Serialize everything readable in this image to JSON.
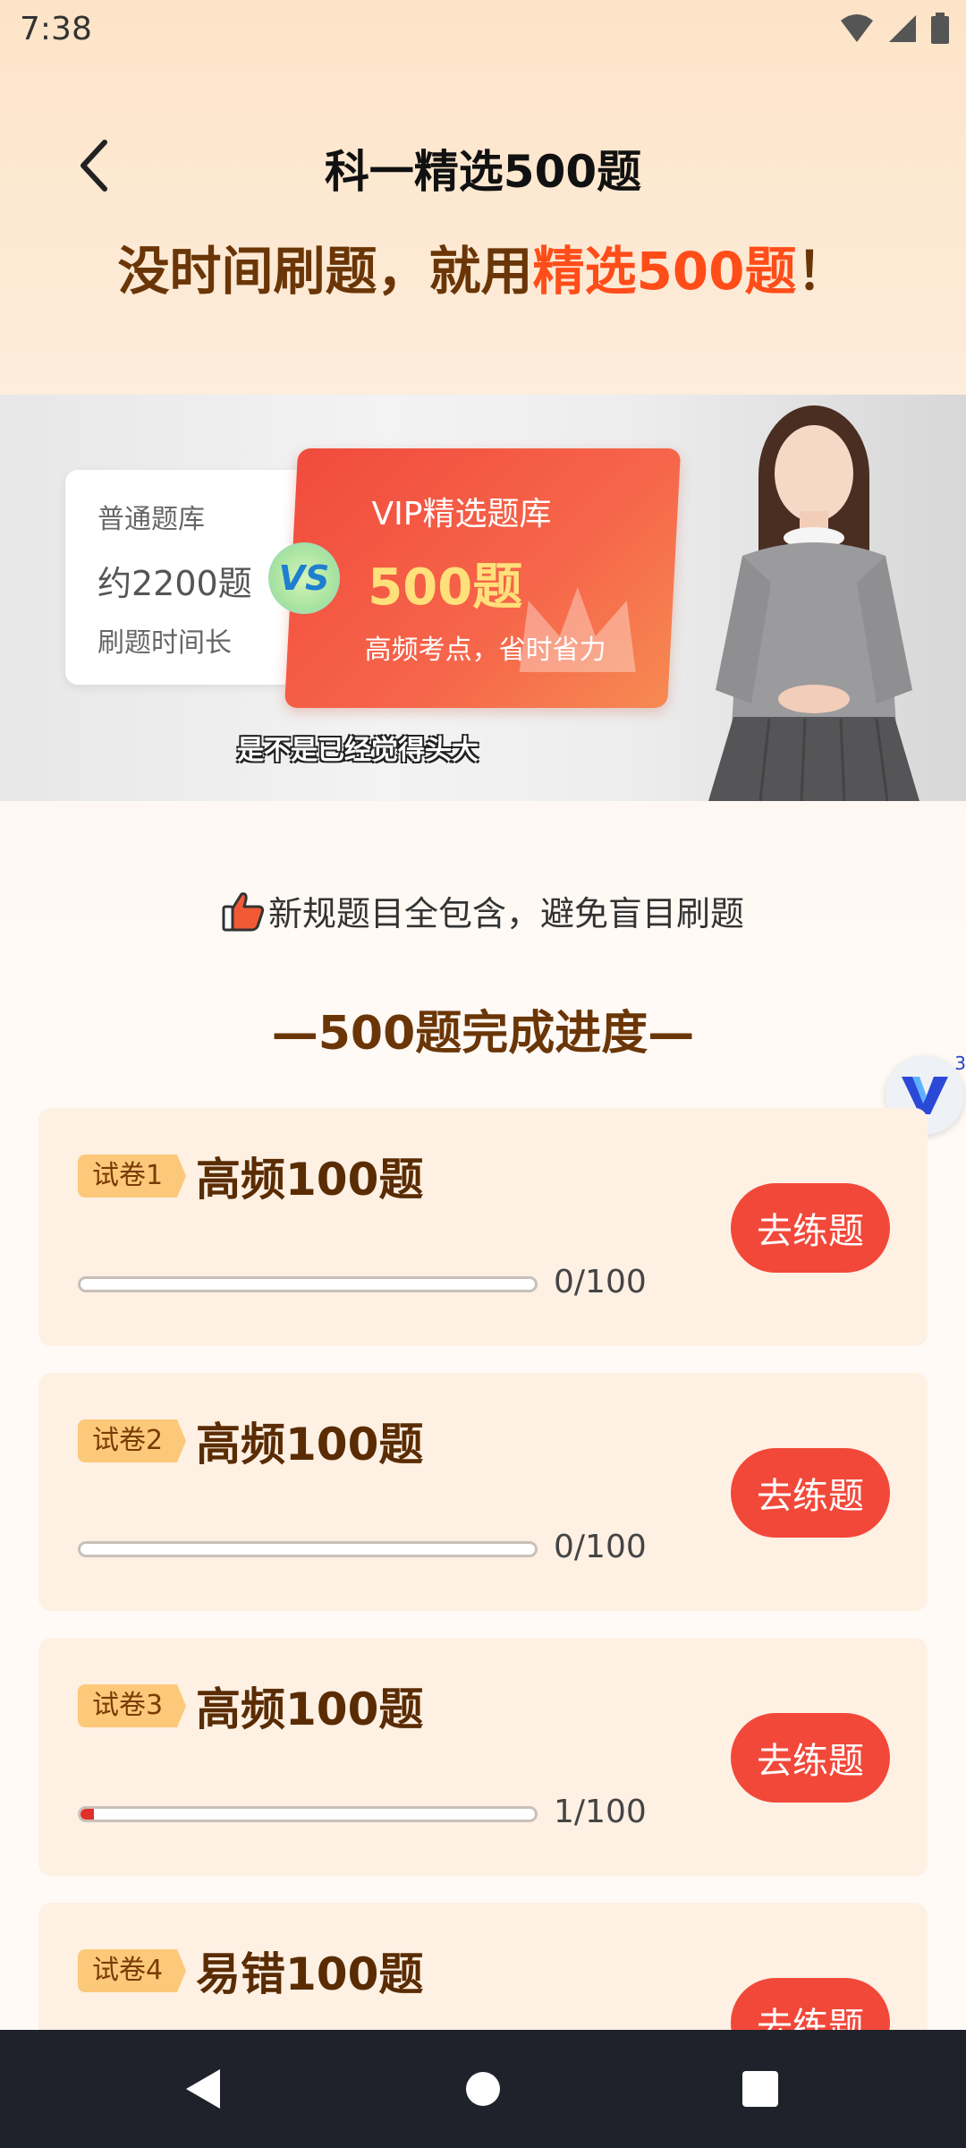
{
  "status_bar": {
    "time": "7:38"
  },
  "header": {
    "title": "科一精选500题"
  },
  "slogan": {
    "prefix": "没时间刷题，就用",
    "highlight": "精选500题",
    "suffix": "！"
  },
  "banner": {
    "normal_bank": {
      "label": "普通题库",
      "count": "约2200题",
      "note": "刷题时间长"
    },
    "vs": "VS",
    "vip_bank": {
      "label": "VIP精选题库",
      "count": "500题",
      "note": "高频考点，省时省力"
    },
    "caption": "是不是已经觉得头大"
  },
  "feature": {
    "text": "新规题目全包含，避免盲目刷题"
  },
  "section": {
    "title": "—500题完成进度—"
  },
  "floating_badge": {
    "count": "3"
  },
  "papers": [
    {
      "tag": "试卷1",
      "name": "高频100题",
      "progress_text": "0/100",
      "progress": 0,
      "button": "去练题"
    },
    {
      "tag": "试卷2",
      "name": "高频100题",
      "progress_text": "0/100",
      "progress": 0,
      "button": "去练题"
    },
    {
      "tag": "试卷3",
      "name": "高频100题",
      "progress_text": "1/100",
      "progress": 0.01,
      "button": "去练题"
    },
    {
      "tag": "试卷4",
      "name": "易错100题",
      "button": "去练题"
    }
  ],
  "colors": {
    "accent": "#f2483a",
    "title_brown": "#6b3607",
    "highlight": "#ff4d1a",
    "card_bg": "#fef0e3"
  }
}
